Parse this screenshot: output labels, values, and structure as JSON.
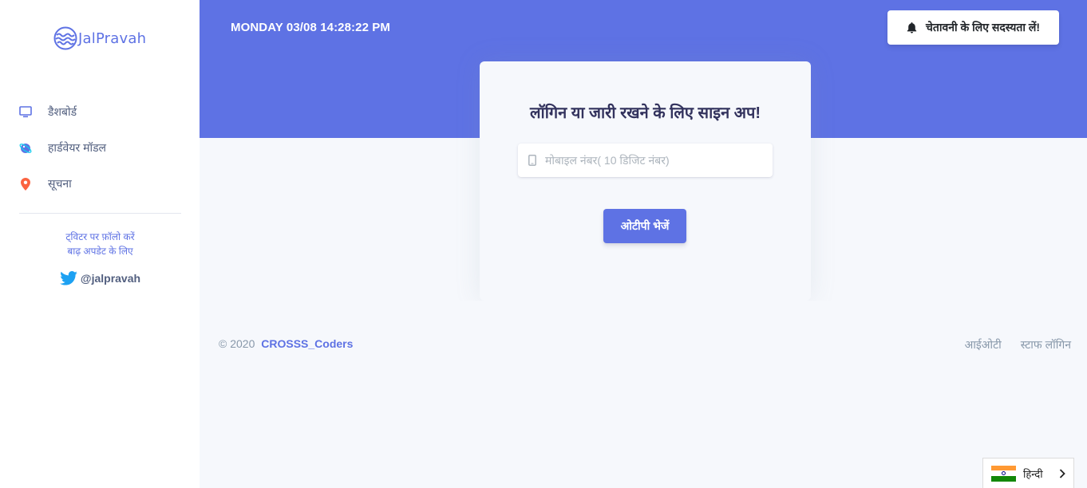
{
  "brand": {
    "name": "JalPravah"
  },
  "sidebar": {
    "items": [
      {
        "label": "डैशबोर्ड",
        "icon": "monitor-icon"
      },
      {
        "label": "हार्डवेयर मॉडल",
        "icon": "planet-icon"
      },
      {
        "label": "सूचना",
        "icon": "pin-icon"
      }
    ],
    "follow_line1": "ट्विटर पर फ़ॉलो करें",
    "follow_line2": "बाढ़ अपडेट के लिए",
    "twitter_handle": "@jalpravah"
  },
  "header": {
    "datetime": "MONDAY 03/08 14:28:22 PM",
    "subscribe_label": "चेतावनी के लिए सदस्यता लें!"
  },
  "login": {
    "title": "लॉगिन या जारी रखने के लिए साइन अप!",
    "phone_placeholder": "मोबाइल नंबर( 10 डिजिट नंबर)",
    "otp_button": "ओटीपी भेजें"
  },
  "footer": {
    "copyright": "© 2020",
    "team": "CROSSS_Coders",
    "links": [
      "आईओटी",
      "स्टाफ लॉगिन"
    ]
  },
  "language": {
    "selected": "हिन्दी"
  },
  "colors": {
    "primary": "#5e72e4",
    "background": "#f6f8fc",
    "text": "#525f7f",
    "pin": "#f5365c"
  }
}
